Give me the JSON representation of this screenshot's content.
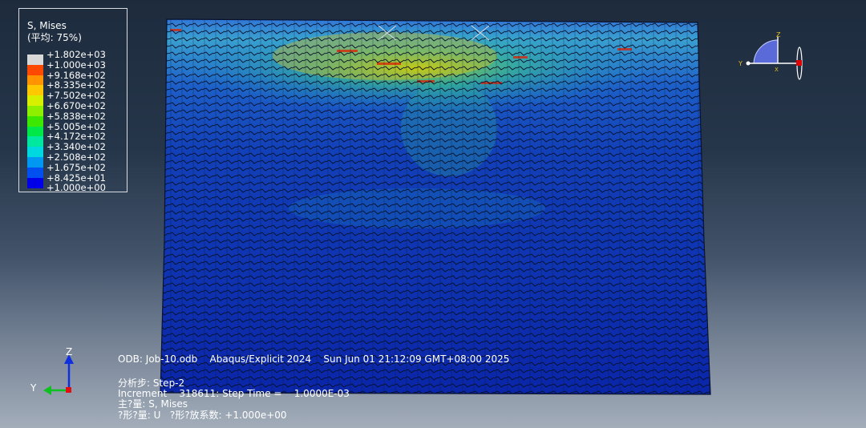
{
  "legend": {
    "title": "S, Mises",
    "subtitle": "(平均: 75%)",
    "entries": [
      {
        "value": "+1.802e+03",
        "color": "#d8d8d8"
      },
      {
        "value": "+1.000e+03",
        "color": "#e80000"
      },
      {
        "value": "+9.168e+02",
        "color": "#ff4800"
      },
      {
        "value": "+8.335e+02",
        "color": "#ff9400"
      },
      {
        "value": "+7.502e+02",
        "color": "#ffc800"
      },
      {
        "value": "+6.670e+02",
        "color": "#d6f000"
      },
      {
        "value": "+5.838e+02",
        "color": "#8ef000"
      },
      {
        "value": "+5.005e+02",
        "color": "#3ce800"
      },
      {
        "value": "+4.172e+02",
        "color": "#00e848"
      },
      {
        "value": "+3.340e+02",
        "color": "#00e8a0"
      },
      {
        "value": "+2.508e+02",
        "color": "#00d8e0"
      },
      {
        "value": "+1.675e+02",
        "color": "#0098f0"
      },
      {
        "value": "+8.425e+01",
        "color": "#0050f0"
      },
      {
        "value": "+1.000e+00",
        "color": "#0000e8"
      }
    ]
  },
  "info": {
    "odb_line": "ODB: Job-10.odb    Abaqus/Explicit 2024    Sun Jun 01 21:12:09 GMT+08:00 2025",
    "step_line": "分析步: Step-2",
    "increment_line": "Increment    318611: Step Time =    1.0000E-03",
    "primary_line": "主?量: S, Mises",
    "deformed_line": "?形?量: U   ?形?放系数: +1.000e+00"
  },
  "triad_bottom": {
    "z_label": "Z",
    "y_label": "Y"
  },
  "triad_top": {
    "z_label": "Z",
    "y_label": "Y",
    "x_label": "X"
  }
}
